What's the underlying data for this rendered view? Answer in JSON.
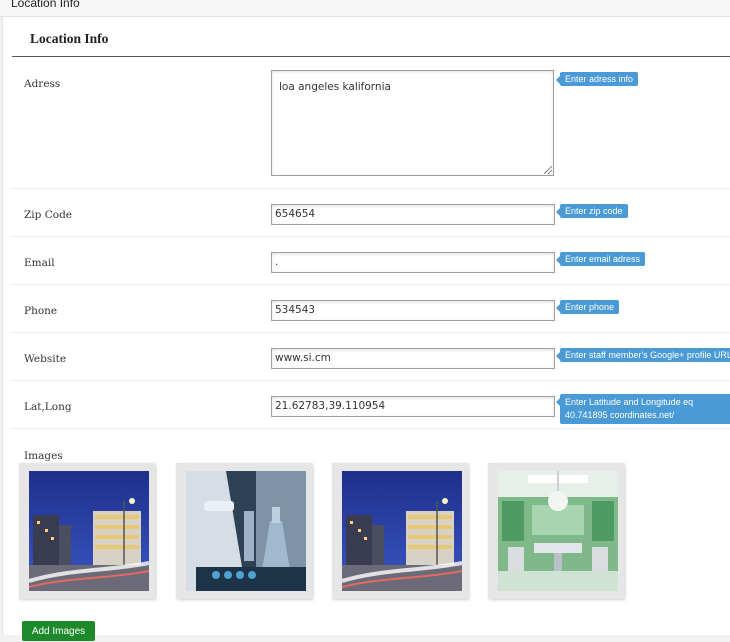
{
  "top_tab_title": "Location Info",
  "panel_title": "Location Info",
  "fields": [
    {
      "label": "Adress",
      "value": "loa angeles kalifornia",
      "tip": "Enter adress info"
    },
    {
      "label": "Zip Code",
      "value": "654654",
      "tip": "Enter zip code"
    },
    {
      "label": "Email",
      "value": ".",
      "tip": "Enter email adress"
    },
    {
      "label": "Phone",
      "value": "534543",
      "tip": "Enter phone"
    },
    {
      "label": "Website",
      "value": "www.si.cm",
      "tip": "Enter staff member's Google+ profile URL."
    },
    {
      "label": "Lat,Long",
      "value": "21.62783,39.110954",
      "tip": "Enter Latitude and Longitude eq 40.741895 coordinates.net/"
    }
  ],
  "images_label": "Images",
  "images": [
    {
      "icon": "night-city-building-image"
    },
    {
      "icon": "laboratory-image"
    },
    {
      "icon": "night-city-building-image"
    },
    {
      "icon": "operating-room-image"
    }
  ],
  "add_images_label": "Add Images",
  "colors": {
    "tip": "#4a9ad6",
    "add_button": "#1c8a2a"
  }
}
